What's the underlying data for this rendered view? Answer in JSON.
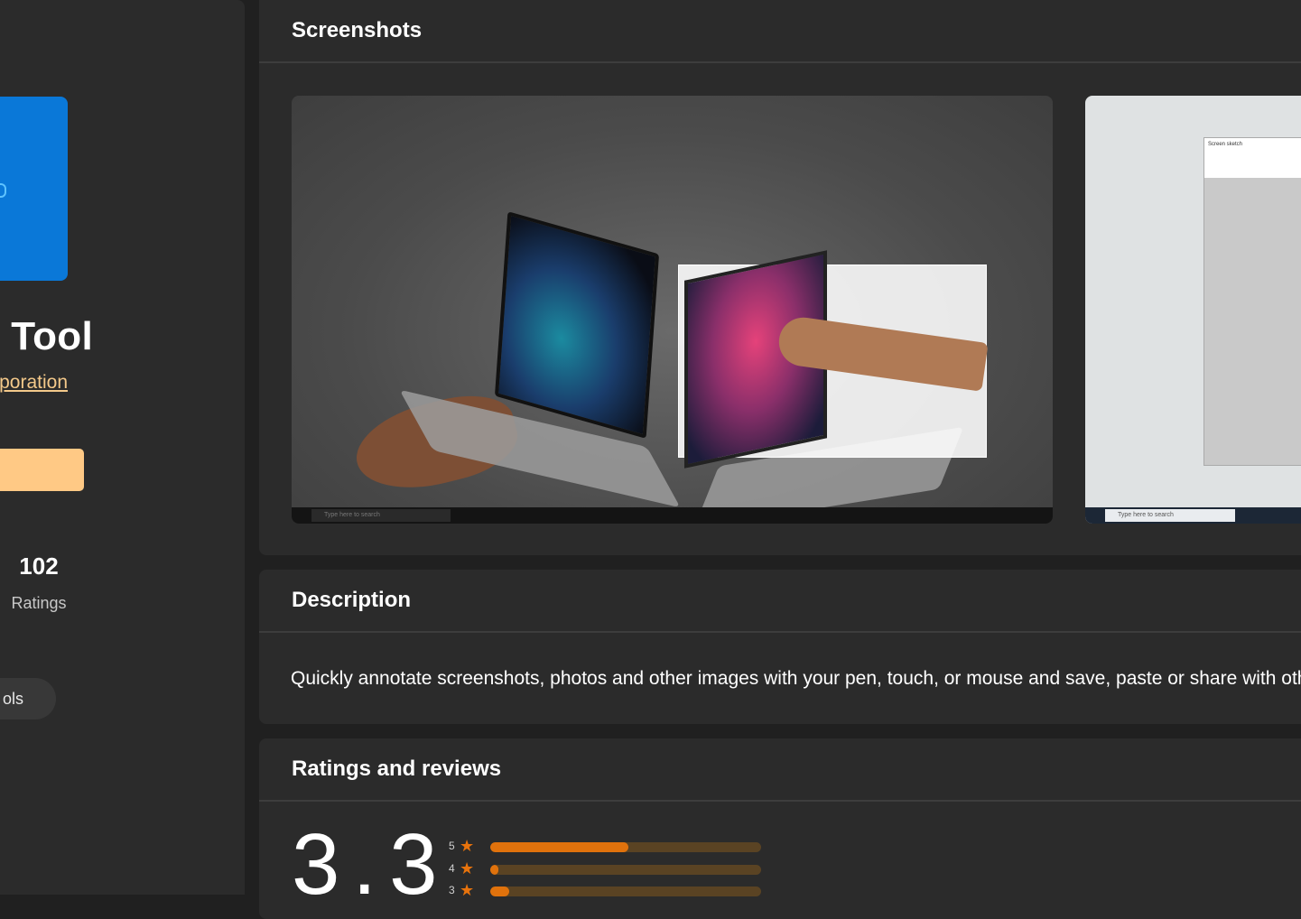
{
  "app": {
    "title": "Snip & Sketch Tool",
    "title_visible": "g Tool",
    "publisher": "Microsoft Corporation",
    "publisher_visible": "poration",
    "rating_count": "102",
    "rating_count_label": "Ratings",
    "category_visible": "ols",
    "icon": "snip-sketch-app-icon"
  },
  "screenshots": {
    "title": "Screenshots",
    "items": [
      {
        "name": "laptops-screenshot",
        "search_text": "Type here to search"
      },
      {
        "name": "screen-sketch-screenshot",
        "window_title": "Screen sketch",
        "search_text": "Type here to search"
      }
    ]
  },
  "description": {
    "title": "Description",
    "text": "Quickly annotate screenshots, photos and other images with your pen, touch, or mouse and save, paste or share with oth"
  },
  "ratings": {
    "title": "Ratings and reviews",
    "average": "3.3",
    "breakdown": [
      {
        "stars": "5",
        "fraction": 0.51
      },
      {
        "stars": "4",
        "fraction": 0.03
      },
      {
        "stars": "3",
        "fraction": 0.07
      }
    ]
  },
  "colors": {
    "background": "#202020",
    "card": "#2b2b2b",
    "accent_button": "#ffc985",
    "accent_link": "#f4c98a",
    "rating_bar": "#e0720c",
    "rating_track": "#5a4323",
    "app_icon": "#0a78d8"
  }
}
